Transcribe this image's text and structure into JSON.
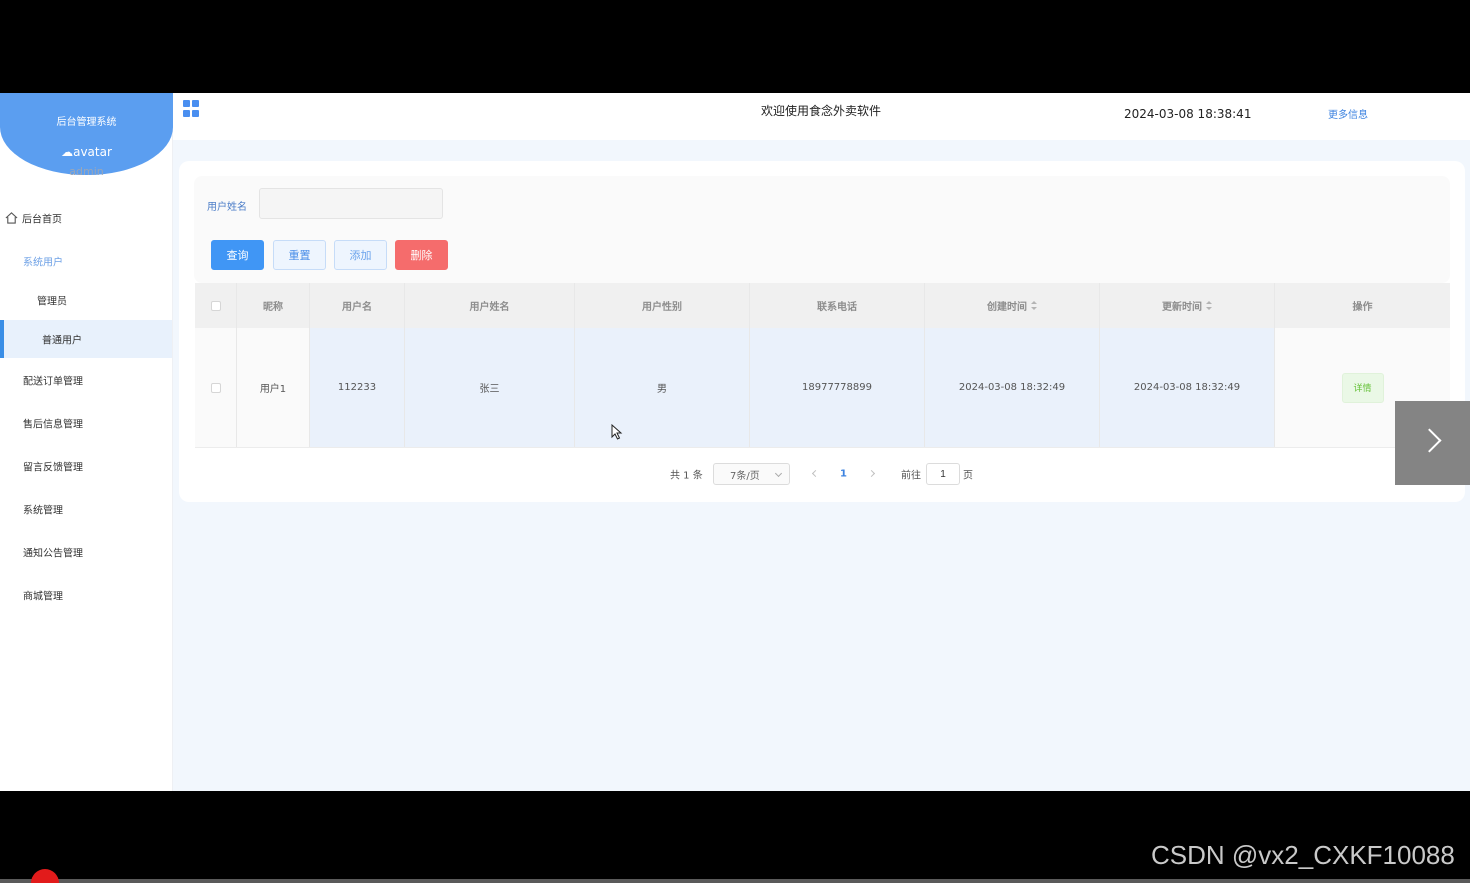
{
  "sidebar": {
    "system_name": "后台管理系统",
    "avatar_alt": "avatar",
    "username": "admin",
    "items": [
      {
        "label": "后台首页"
      },
      {
        "label": "系统用户"
      },
      {
        "label": "管理员"
      },
      {
        "label": "普通用户"
      },
      {
        "label": "配送订单管理"
      },
      {
        "label": "售后信息管理"
      },
      {
        "label": "留言反馈管理"
      },
      {
        "label": "系统管理"
      },
      {
        "label": "通知公告管理"
      },
      {
        "label": "商城管理"
      }
    ]
  },
  "header": {
    "welcome": "欢迎使用食念外卖软件",
    "datetime": "2024-03-08 18:38:41",
    "more": "更多信息"
  },
  "search": {
    "label": "用户姓名",
    "value": "",
    "placeholder": ""
  },
  "toolbar": {
    "query": "查询",
    "reset": "重置",
    "add": "添加",
    "delete": "删除"
  },
  "table": {
    "columns": [
      "昵称",
      "用户名",
      "用户姓名",
      "用户性别",
      "联系电话",
      "创建时间",
      "更新时间",
      "操作"
    ],
    "rows": [
      {
        "nickname": "用户1",
        "username": "112233",
        "realname": "张三",
        "gender": "男",
        "phone": "18977778899",
        "created": "2024-03-08 18:32:49",
        "updated": "2024-03-08 18:32:49",
        "action": "详情"
      }
    ]
  },
  "pagination": {
    "total": "共 1 条",
    "page_size": "7条/页",
    "current": "1",
    "goto_label": "前往",
    "goto_value": "1",
    "page_unit": "页"
  },
  "overlay": {
    "watermark": "CSDN @vx2_CXKF10088"
  },
  "colors": {
    "primary": "#4096f5",
    "danger": "#f56c6c",
    "success": "#67c23a",
    "brand": "#5b9ef0"
  }
}
